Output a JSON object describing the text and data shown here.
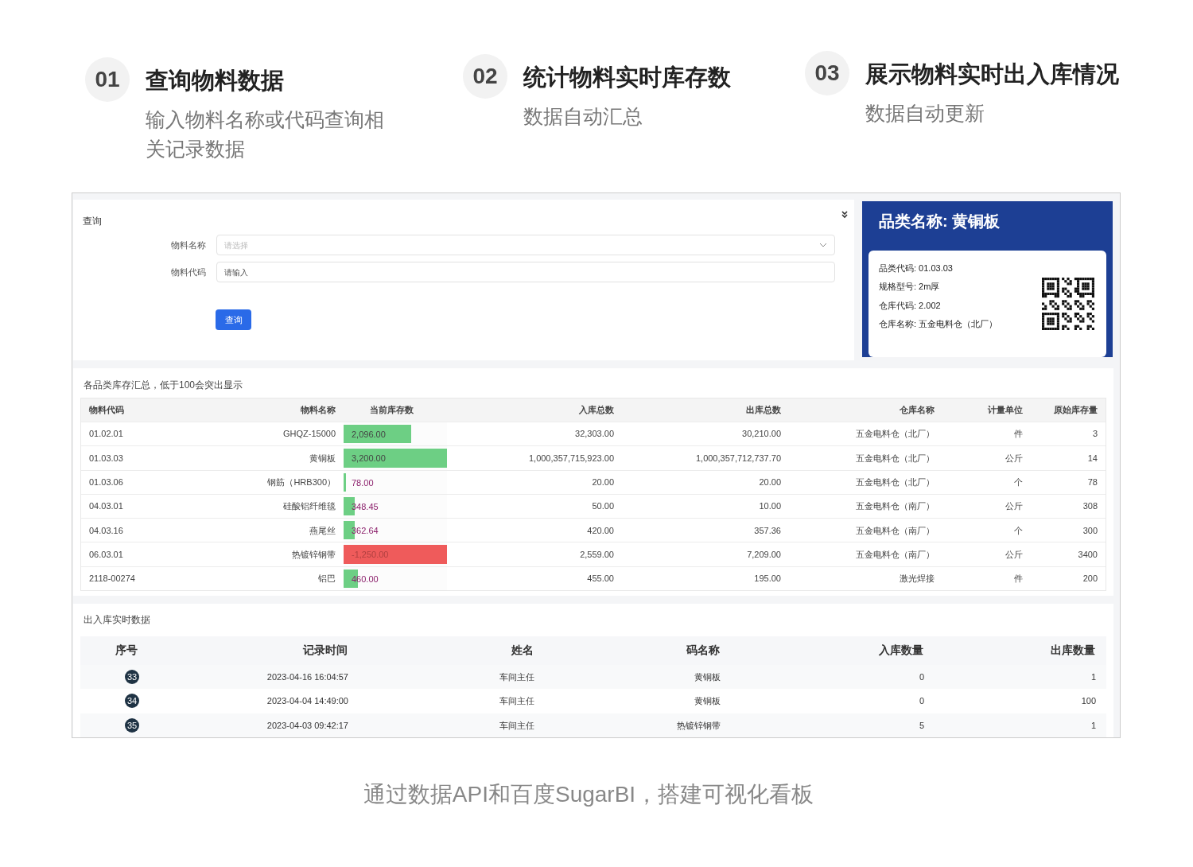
{
  "steps": [
    {
      "number": "01",
      "title": "查询物料数据",
      "description": "输入物料名称或代码查询相关记录数据"
    },
    {
      "number": "02",
      "title": "统计物料实时库存数",
      "description": "数据自动汇总"
    },
    {
      "number": "03",
      "title": "展示物料实时出入库情况",
      "description": "数据自动更新"
    }
  ],
  "query_panel": {
    "title": "查询",
    "fields": [
      {
        "kind": "select",
        "label": "物料名称",
        "placeholder": "请选择"
      },
      {
        "kind": "text",
        "label": "物料代码",
        "placeholder": "请输入"
      }
    ],
    "button": "查询"
  },
  "category_card": {
    "title": "品类名称: 黄铜板",
    "lines": [
      "品类代码: 01.03.03",
      "规格型号: 2m厚",
      "仓库代码: 2.002",
      "仓库名称: 五金电料仓（北厂）"
    ]
  },
  "inventory": {
    "title": "各品类库存汇总，低于100会突出显示",
    "columns": [
      "物料代码",
      "物料名称",
      "当前库存数",
      "入库总数",
      "出库总数",
      "仓库名称",
      "计量单位",
      "原始库存量"
    ],
    "rows": [
      {
        "code": "01.02.01",
        "name": "GHQZ-15000",
        "stock": "2,096.00",
        "level": 0.65,
        "negative": false,
        "highlight": false,
        "in": "32,303.00",
        "out": "30,210.00",
        "warehouse": "五金电料仓（北厂）",
        "unit": "件",
        "original": "3"
      },
      {
        "code": "01.03.03",
        "name": "黄铜板",
        "stock": "3,200.00",
        "level": 1,
        "negative": false,
        "highlight": false,
        "in": "1,000,357,715,923.00",
        "out": "1,000,357,712,737.70",
        "warehouse": "五金电料仓（北厂）",
        "unit": "公斤",
        "original": "14"
      },
      {
        "code": "01.03.06",
        "name": "钢筋（HRB300）",
        "stock": "78.00",
        "level": 0.02,
        "negative": false,
        "highlight": true,
        "in": "20.00",
        "out": "20.00",
        "warehouse": "五金电料仓（北厂）",
        "unit": "个",
        "original": "78"
      },
      {
        "code": "04.03.01",
        "name": "硅酸铝纤维毯",
        "stock": "348.45",
        "level": 0.11,
        "negative": false,
        "highlight": true,
        "in": "50.00",
        "out": "10.00",
        "warehouse": "五金电料仓（南厂）",
        "unit": "公斤",
        "original": "308"
      },
      {
        "code": "04.03.16",
        "name": "燕尾丝",
        "stock": "362.64",
        "level": 0.11,
        "negative": false,
        "highlight": true,
        "in": "420.00",
        "out": "357.36",
        "warehouse": "五金电料仓（南厂）",
        "unit": "个",
        "original": "300"
      },
      {
        "code": "06.03.01",
        "name": "热镀锌钢带",
        "stock": "-1,250.00",
        "level": 1,
        "negative": true,
        "highlight": false,
        "in": "2,559.00",
        "out": "7,209.00",
        "warehouse": "五金电料仓（南厂）",
        "unit": "公斤",
        "original": "3400"
      },
      {
        "code": "2118-00274",
        "name": "铝巴",
        "stock": "460.00",
        "level": 0.14,
        "negative": false,
        "highlight": true,
        "in": "455.00",
        "out": "195.00",
        "warehouse": "激光焊接",
        "unit": "件",
        "original": "200"
      }
    ]
  },
  "records": {
    "title": "出入库实时数据",
    "columns": [
      "序号",
      "记录时间",
      "姓名",
      "码名称",
      "入库数量",
      "出库数量"
    ],
    "rows": [
      {
        "no": "33",
        "time": "2023-04-16 16:04:57",
        "name": "车间主任",
        "item": "黄铜板",
        "in": "0",
        "out": "1"
      },
      {
        "no": "34",
        "time": "2023-04-04 14:49:00",
        "name": "车间主任",
        "item": "黄铜板",
        "in": "0",
        "out": "100"
      },
      {
        "no": "35",
        "time": "2023-04-03 09:42:17",
        "name": "车间主任",
        "item": "热镀锌钢带",
        "in": "5",
        "out": "1"
      }
    ]
  },
  "caption": "通过数据API和百度SugarBI，搭建可视化看板"
}
